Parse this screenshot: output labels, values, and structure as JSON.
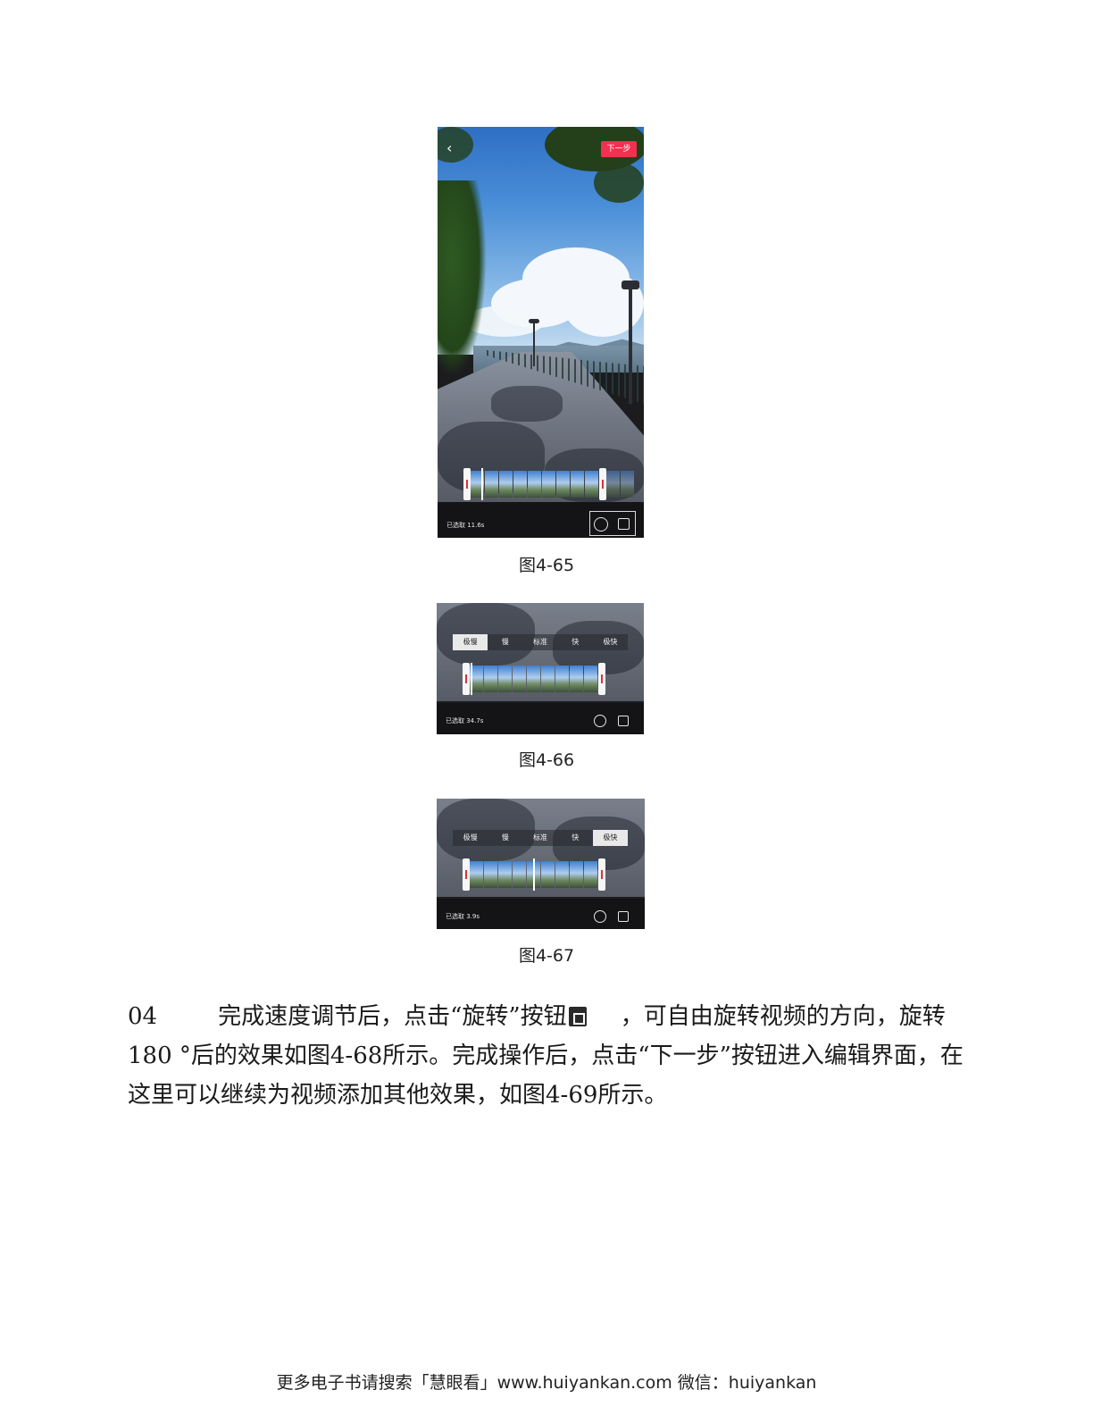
{
  "figures": [
    {
      "caption": "图4-65",
      "next_button": "下一步",
      "selected_label": "已选取 11.6s"
    },
    {
      "caption": "图4-66",
      "speed_options": [
        "极慢",
        "慢",
        "标准",
        "快",
        "极快"
      ],
      "active_speed": "极慢",
      "selected_label": "已选取 34.7s"
    },
    {
      "caption": "图4-67",
      "speed_options": [
        "极慢",
        "慢",
        "标准",
        "快",
        "极快"
      ],
      "active_speed": "极快",
      "selected_label": "已选取 3.9s"
    }
  ],
  "body": {
    "step": "04",
    "text_part1": "完成速度调节后，点击“旋转”按钮",
    "text_part2": "，可自由旋转视频的方向，旋转180 °后的效果如图4-68所示。完成操作后，点击“下一步”按钮进入编辑界面，在这里可以继续为视频添加其他效果，如图4-69所示。"
  },
  "footer": "更多电子书请搜索「慧眼看」www.huiyankan.com   微信：huiyankan"
}
